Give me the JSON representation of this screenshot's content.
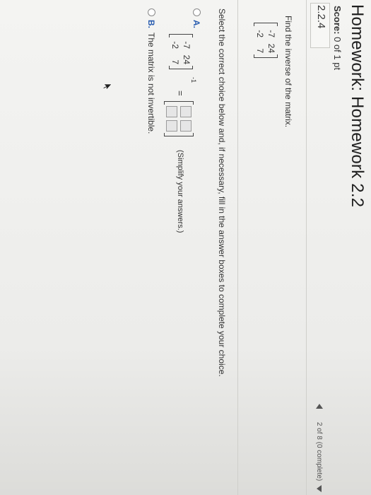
{
  "header": {
    "title": "Homework: Homework 2.2",
    "score_label": "Score:",
    "score_value": "0 of 1 pt"
  },
  "question": {
    "number": "2.2.4",
    "nav_status": "2 of 8 (0 complete)",
    "prompt": "Find the inverse of the matrix.",
    "matrix": [
      "-7",
      "24",
      "-2",
      "7"
    ],
    "instruction": "Select the correct choice below and, if necessary, fill in the answer boxes to complete your choice."
  },
  "options": {
    "a_letter": "A.",
    "a_matrix": [
      "-7",
      "24",
      "-2",
      "7"
    ],
    "a_exponent": "-1",
    "a_equals": "=",
    "a_hint": "(Simplify your answers.)",
    "b_letter": "B.",
    "b_text": "The matrix is not invertible."
  },
  "icons": {
    "nav_prev": "triangle-left-icon",
    "nav_menu": "triangle-down-icon",
    "cursor": "mouse-pointer-icon"
  }
}
